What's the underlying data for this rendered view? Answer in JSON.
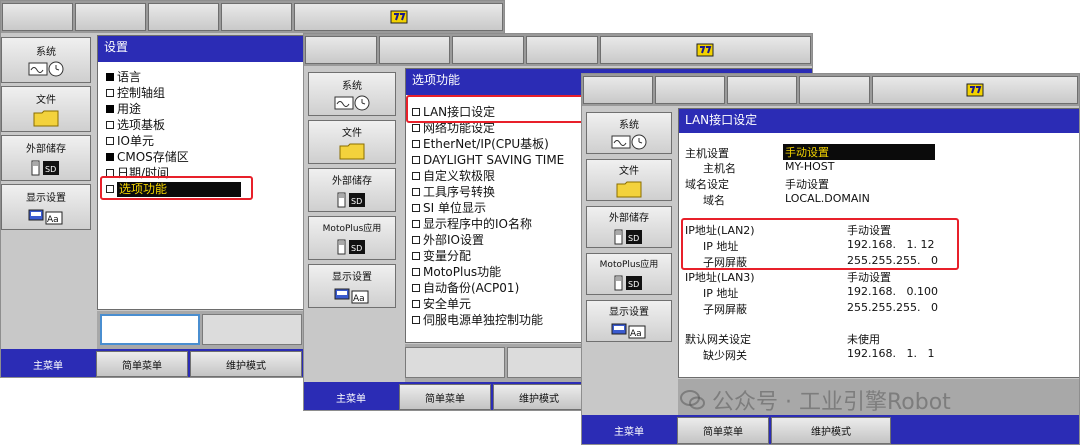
{
  "win1": {
    "sidebar": [
      "系统",
      "文件",
      "外部储存",
      "显示设置"
    ],
    "title": "设置",
    "items": [
      {
        "label": "语言",
        "filled": true
      },
      {
        "label": "控制轴组",
        "filled": false
      },
      {
        "label": "用途",
        "filled": true
      },
      {
        "label": "选项基板",
        "filled": false
      },
      {
        "label": "IO单元",
        "filled": false
      },
      {
        "label": "CMOS存储区",
        "filled": true
      },
      {
        "label": "日期/时间",
        "filled": false
      },
      {
        "label": "选项功能",
        "filled": false
      }
    ],
    "tabs": [
      "主菜单",
      "简单菜单",
      "维护模式"
    ]
  },
  "win2": {
    "sidebar": [
      "系统",
      "文件",
      "外部储存",
      "MotoPlus应用",
      "显示设置"
    ],
    "title": "选项功能",
    "items": [
      "LAN接口设定",
      "网络功能设定",
      "EtherNet/IP(CPU基板)",
      "DAYLIGHT SAVING TIME",
      "自定义软极限",
      "工具序号转换",
      "SI 单位显示",
      "显示程序中的IO名称",
      "外部IO设置",
      "变量分配",
      "MotoPlus功能",
      "自动备份(ACP01)",
      "安全单元",
      "伺服电源单独控制功能"
    ],
    "tabs": [
      "主菜单",
      "简单菜单",
      "维护模式"
    ]
  },
  "win3": {
    "sidebar": [
      "系统",
      "文件",
      "外部储存",
      "MotoPlus应用",
      "显示设置"
    ],
    "title": "LAN接口设定",
    "rows": [
      {
        "label": "主机设置",
        "value": "手动设置",
        "highlight": true
      },
      {
        "label": "主机名",
        "value": "MY-HOST"
      },
      {
        "label": "域名设定",
        "value": "手动设置"
      },
      {
        "label": "域名",
        "value": "LOCAL.DOMAIN"
      },
      {
        "label": "IP地址(LAN2)",
        "value": "手动设置"
      },
      {
        "label": "IP 地址",
        "value": "192.168.   1. 12"
      },
      {
        "label": "子网屏蔽",
        "value": "255.255.255.   0"
      },
      {
        "label": "IP地址(LAN3)",
        "value": "手动设置"
      },
      {
        "label": "IP 地址",
        "value": "192.168.   0.100"
      },
      {
        "label": "子网屏蔽",
        "value": "255.255.255.   0"
      },
      {
        "label": "默认网关设定",
        "value": "未使用"
      },
      {
        "label": "缺少网关",
        "value": "192.168.   1.   1"
      }
    ],
    "tabs": [
      "主菜单",
      "简单菜单",
      "维护模式"
    ]
  },
  "watermark": "公众号 · 工业引擎Robot",
  "colors": {
    "accent": "#2b2cb5",
    "annotation": "#e8202a",
    "highlight_text": "#f5d400"
  }
}
